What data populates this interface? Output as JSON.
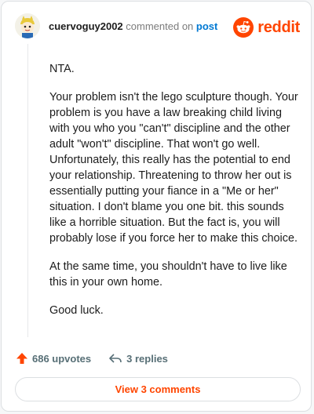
{
  "header": {
    "username": "cuervoguy2002",
    "commented_on": "commented on",
    "post_link": "post",
    "brand": "reddit"
  },
  "comment": {
    "paragraphs": [
      "NTA.",
      "Your problem isn't the lego sculpture though. Your problem is you have a law breaking child living with you who you \"can't\" discipline and the other adult \"won't\" discipline. That won't go well. Unfortunately, this really has the potential to end your relationship. Threatening to throw her out is essentially putting your fiance in a \"Me or her\" situation. I don't blame you one bit. this sounds like a horrible situation. But the fact is, you will probably lose if you force her to make this choice.",
      "At the same time, you shouldn't have to live like this in your own home.",
      "Good luck."
    ]
  },
  "footer": {
    "upvotes": "686 upvotes",
    "replies": "3 replies",
    "view_comments": "View 3 comments"
  },
  "colors": {
    "brand": "#ff4500",
    "link": "#0079d3",
    "muted": "#576f76"
  },
  "icons": {
    "avatar": "avatar-character",
    "brand": "reddit-snoo-icon",
    "upvote": "upvote-arrow-icon",
    "reply": "reply-arrow-icon"
  }
}
